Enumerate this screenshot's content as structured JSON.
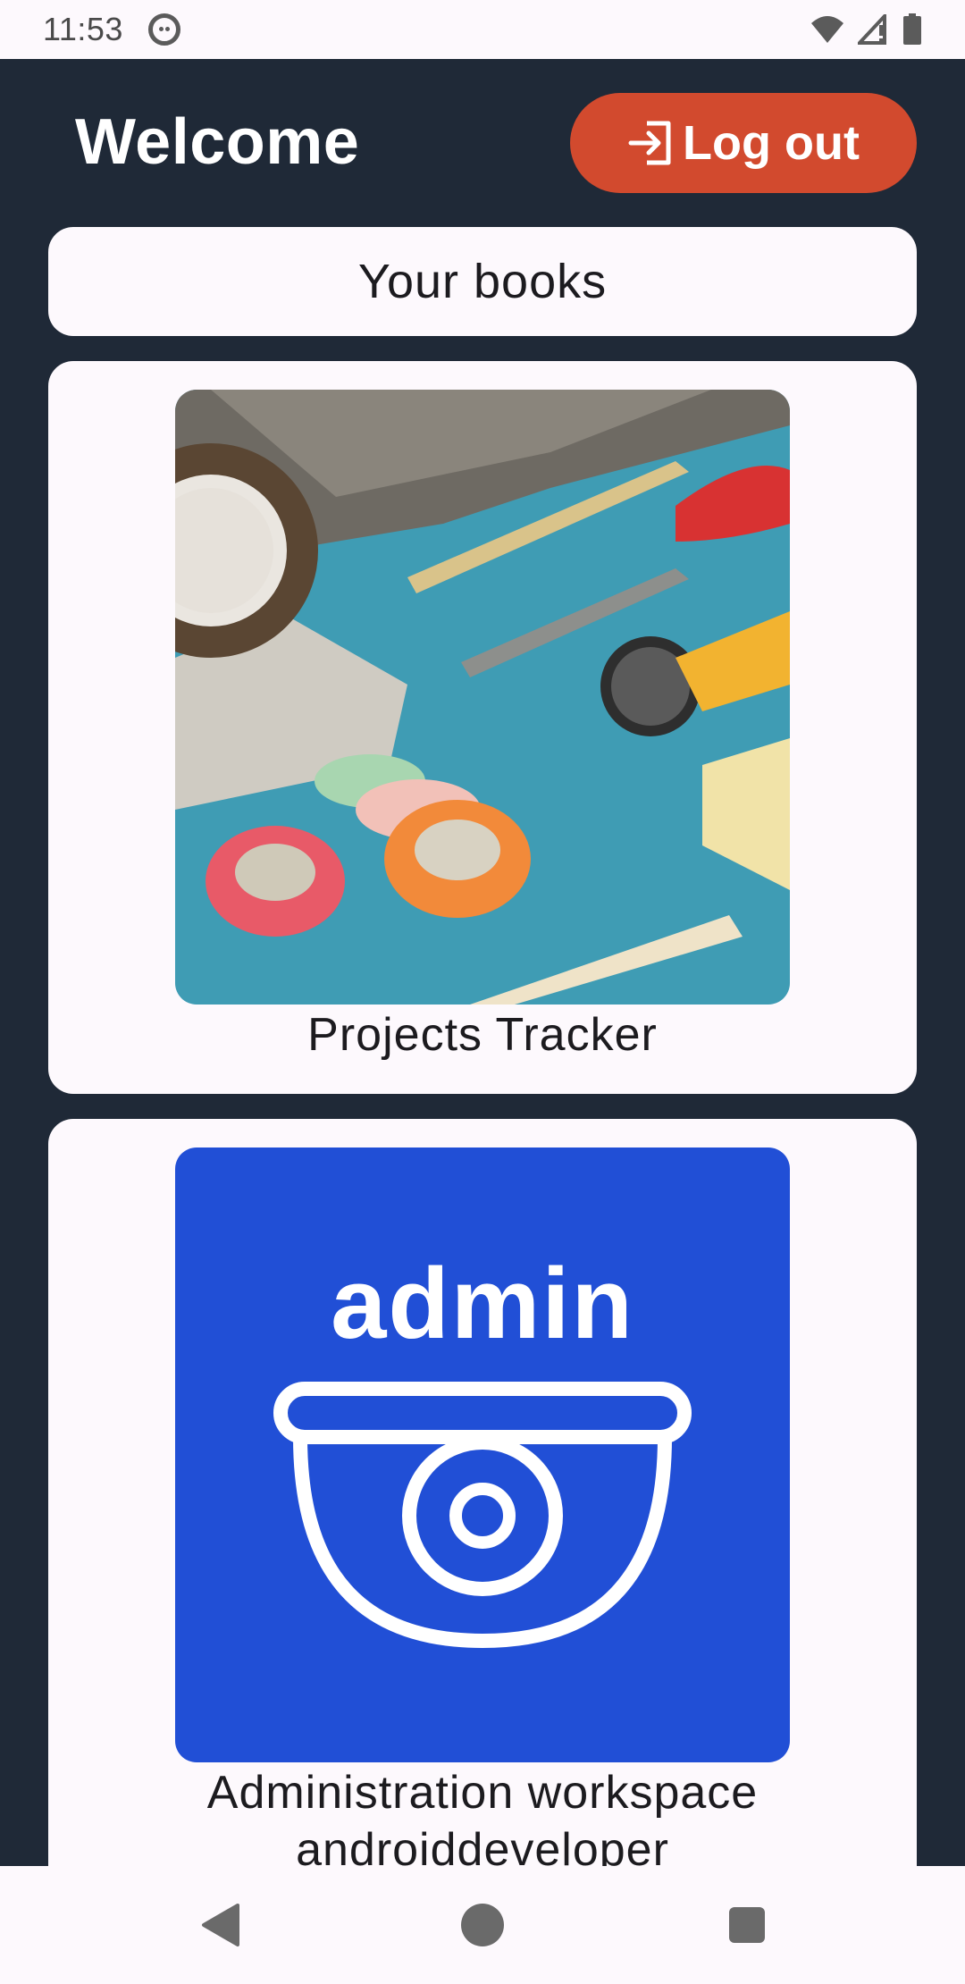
{
  "status_bar": {
    "time": "11:53",
    "icons": [
      "android-app-icon",
      "wifi-icon",
      "cell-signal-icon",
      "battery-icon"
    ]
  },
  "header": {
    "title": "Welcome",
    "logout_label": "Log out",
    "logout_icon": "logout-icon",
    "logout_color": "#d24a2e"
  },
  "section": {
    "title": "Your books"
  },
  "books": [
    {
      "title": "Projects Tracker",
      "cover": "craft-supplies-photo"
    },
    {
      "title": "Administration workspace\nandroiddeveloper",
      "cover_text": "admin",
      "cover_icon": "security-camera-icon",
      "cover_color": "#214fd6"
    }
  ],
  "nav": {
    "icons": [
      "back-icon",
      "home-icon",
      "recents-icon"
    ]
  },
  "colors": {
    "background": "#1f2937",
    "surface": "#fdf9fd"
  }
}
